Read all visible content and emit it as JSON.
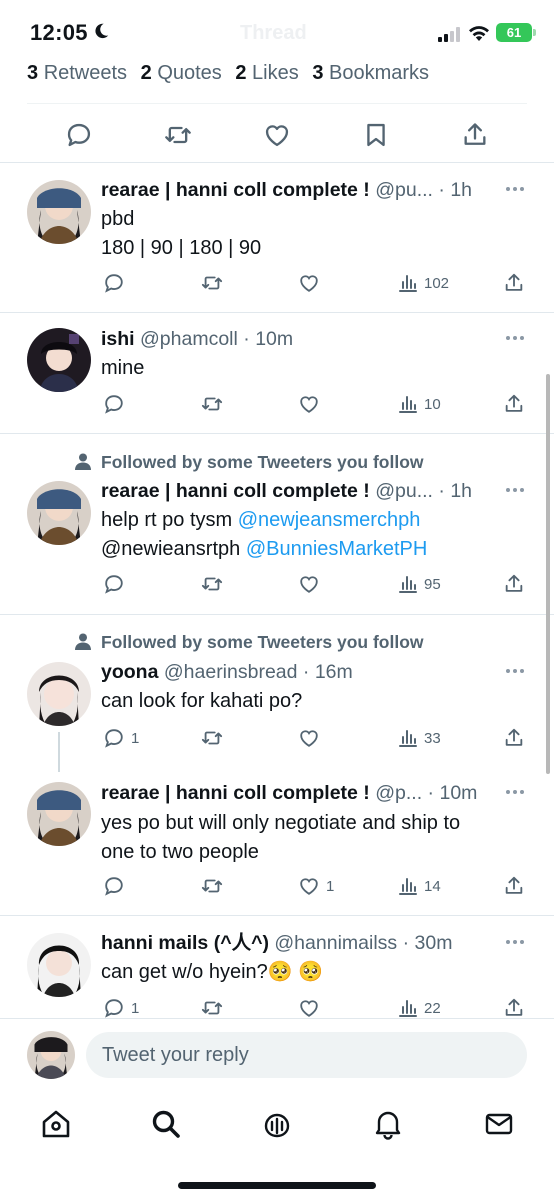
{
  "status_bar": {
    "time": "12:05",
    "battery": "61"
  },
  "header": {
    "title": "Thread"
  },
  "stats": [
    {
      "count": "3",
      "label": "Retweets"
    },
    {
      "count": "2",
      "label": "Quotes"
    },
    {
      "count": "2",
      "label": "Likes"
    },
    {
      "count": "3",
      "label": "Bookmarks"
    }
  ],
  "tweets": [
    {
      "name": "rearae | hanni coll complete !",
      "handle": "@pu...",
      "time": "1h",
      "social_context": "",
      "lines": [
        "pbd",
        "180 | 90 | 180 | 90"
      ],
      "replies": "",
      "likes": "",
      "views": "102"
    },
    {
      "name": "ishi",
      "handle": "@phamcoll",
      "time": "10m",
      "social_context": "",
      "lines": [
        "mine"
      ],
      "replies": "",
      "likes": "",
      "views": "10"
    },
    {
      "name": "rearae | hanni coll complete !",
      "handle": "@pu...",
      "time": "1h",
      "social_context": "Followed by some Tweeters you follow",
      "text_a": "help rt po tysm ",
      "mention_1": "@newjeansmerchph",
      "text_b": "@newieansrtph ",
      "mention_2": "@BunniesMarketPH",
      "replies": "",
      "likes": "",
      "views": "95"
    },
    {
      "name": "yoona",
      "handle": "@haerinsbread",
      "time": "16m",
      "social_context": "Followed by some Tweeters you follow",
      "lines": [
        "can look for kahati po?"
      ],
      "replies": "1",
      "likes": "",
      "views": "33"
    },
    {
      "name": "rearae | hanni coll complete !",
      "handle": "@p...",
      "time": "10m",
      "social_context": "",
      "lines": [
        "yes po but will only negotiate and ship to",
        "one to two people"
      ],
      "replies": "",
      "likes": "1",
      "views": "14"
    },
    {
      "name": "hanni mails (^人^)",
      "handle": "@hannimailss",
      "time": "30m",
      "social_context": "",
      "lines": [
        "can get w/o hyein?🥺 🥺"
      ],
      "replies": "1",
      "likes": "",
      "views": "22"
    }
  ],
  "reply_bar": {
    "placeholder": "Tweet your reply"
  },
  "tab_bar": {
    "items": [
      "home-icon",
      "search-icon",
      "spaces-icon",
      "notifications-icon",
      "messages-icon"
    ]
  },
  "colors": {
    "link": "#1d9bf0",
    "secondary_text": "#536471",
    "battery": "#34c759"
  }
}
